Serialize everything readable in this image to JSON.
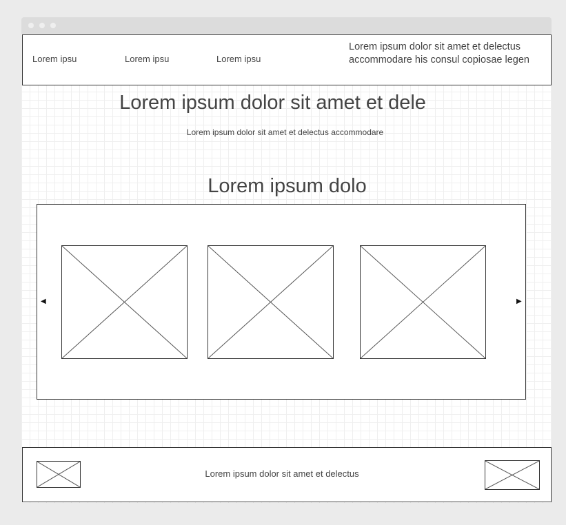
{
  "header": {
    "nav": [
      "Lorem ipsu",
      "Lorem ipsu",
      "Lorem ipsu"
    ],
    "text": "Lorem ipsum dolor sit amet et delectus accommodare his consul copiosae legen"
  },
  "hero": {
    "title": "Lorem ipsum dolor sit amet et dele",
    "subtitle": "Lorem ipsum dolor sit amet et delectus accommodare"
  },
  "gallery": {
    "title": "Lorem ipsum dolo",
    "prev_icon": "◀",
    "next_icon": "▶",
    "item_count": 3
  },
  "footer": {
    "text": "Lorem ipsum dolor sit amet et delectus"
  },
  "icons": {
    "placeholder": "image-placeholder-icon",
    "prev": "left-arrow-icon",
    "next": "right-arrow-icon"
  }
}
